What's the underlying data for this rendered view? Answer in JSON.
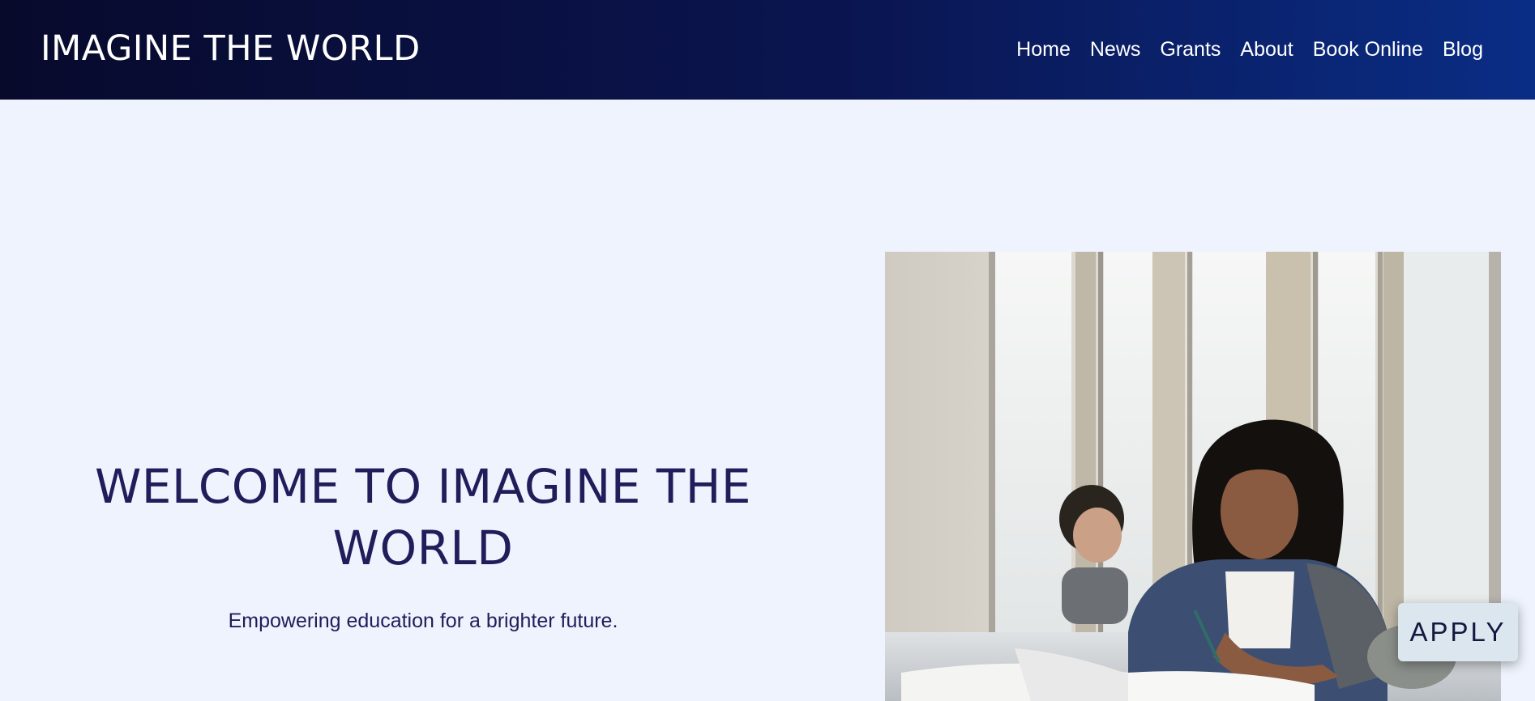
{
  "header": {
    "site_title": "IMAGINE THE WORLD",
    "nav": [
      "Home",
      "News",
      "Grants",
      "About",
      "Book Online",
      "Blog"
    ]
  },
  "hero": {
    "heading": "WELCOME TO IMAGINE THE WORLD",
    "subheading": "Empowering education for a brighter future.",
    "photo": "student-studying-photo"
  },
  "floating": {
    "apply_label": "APPLY"
  },
  "colors": {
    "header_start": "#080a2c",
    "header_end": "#0a2d85",
    "page_background": "#eef3fd",
    "heading_text": "#201d5a",
    "apply_button": "#dbe6ee"
  }
}
